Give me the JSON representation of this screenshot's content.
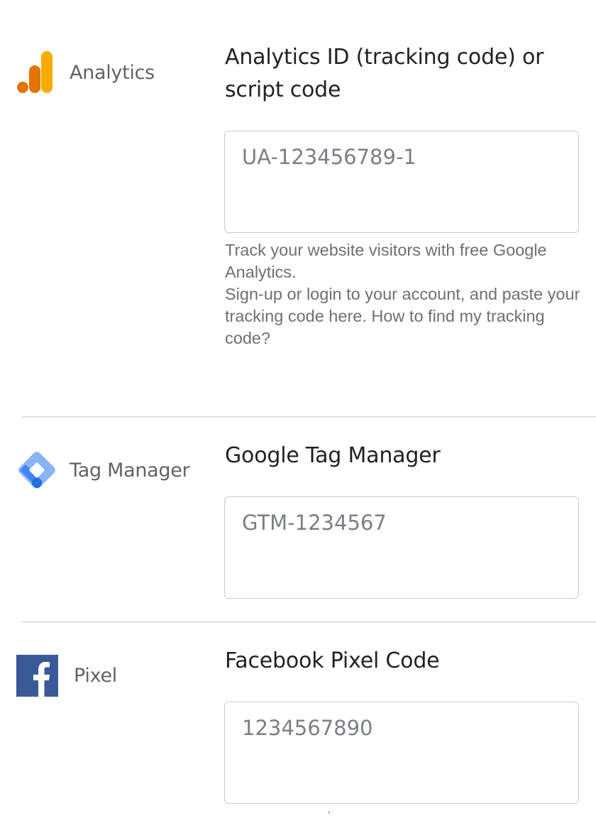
{
  "analytics": {
    "brand_icon": "google-analytics-bars-icon",
    "brand_label": "Analytics",
    "title": "Analytics ID (tracking code) or script code",
    "input_placeholder": "UA-123456789-1",
    "input_value": "",
    "help_line_1": "Track your website visitors with free Google Analytics.",
    "help_line_2": "Sign-up or login to your account, and paste your tracking code here. How to find my tracking code?",
    "colors": {
      "bar_dot": "#e37400",
      "bar_mid": "#e37400",
      "bar_tall": "#f9ab00"
    }
  },
  "tag_manager": {
    "brand_icon": "google-tag-manager-diamond-icon",
    "brand_label": "Tag Manager",
    "title": "Google Tag Manager",
    "input_placeholder": "GTM-1234567",
    "input_value": "",
    "colors": {
      "diamond_light": "#8ab4f8",
      "diamond_dark": "#4285f4",
      "dot": "#246fdb"
    }
  },
  "pixel": {
    "brand_icon": "facebook-f-icon",
    "brand_label": "Pixel",
    "title": "Facebook Pixel Code",
    "input_placeholder": "1234567890",
    "input_value": "",
    "colors": {
      "tile": "#3b5998",
      "letter": "#ffffff"
    }
  }
}
